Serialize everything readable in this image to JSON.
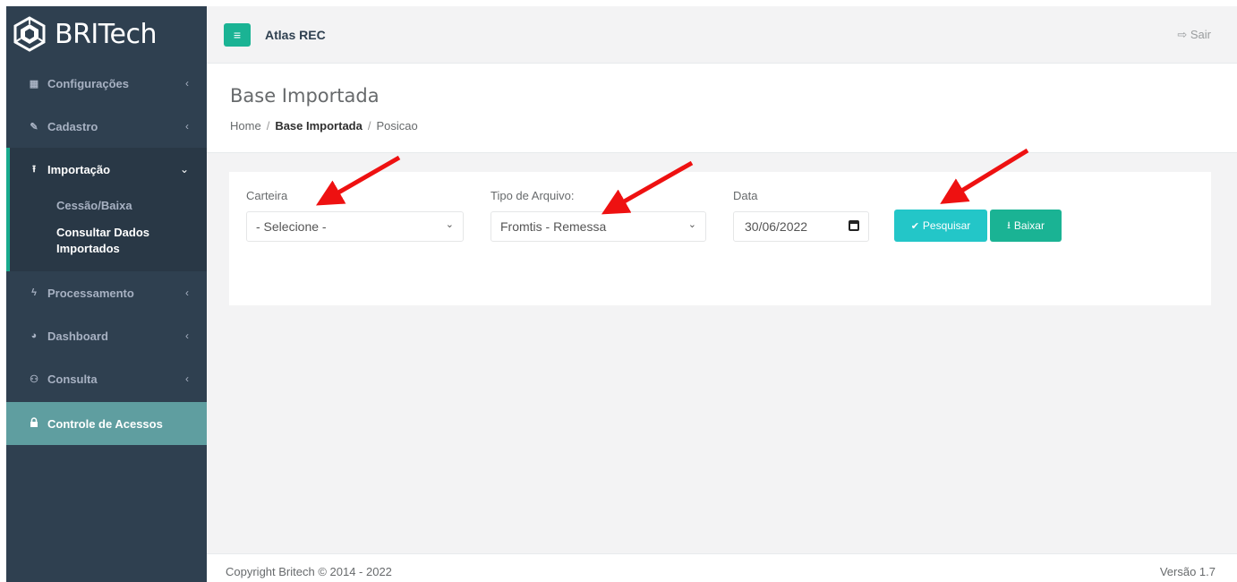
{
  "brand": {
    "name": "BRITech"
  },
  "sidebar": {
    "items": [
      {
        "label": "Configurações",
        "icon": "grid-icon"
      },
      {
        "label": "Cadastro",
        "icon": "edit-icon"
      },
      {
        "label": "Importação",
        "icon": "upload-icon"
      },
      {
        "label": "Processamento",
        "icon": "bolt-icon"
      },
      {
        "label": "Dashboard",
        "icon": "pie-chart-icon"
      },
      {
        "label": "Consulta",
        "icon": "binoculars-icon"
      },
      {
        "label": "Controle de Acessos",
        "icon": "lock-icon"
      }
    ],
    "submenu": [
      {
        "label": "Cessão/Baixa"
      },
      {
        "label": "Consultar Dados Importados"
      }
    ]
  },
  "topbar": {
    "app_title": "Atlas REC",
    "logout_label": "Sair"
  },
  "page": {
    "title": "Base Importada",
    "breadcrumb": [
      "Home",
      "Base Importada",
      "Posicao"
    ]
  },
  "form": {
    "carteira_label": "Carteira",
    "carteira_value": "- Selecione -",
    "tipo_label": "Tipo de Arquivo:",
    "tipo_value": "Fromtis - Remessa",
    "data_label": "Data",
    "data_value": "30/06/2022",
    "search_label": "Pesquisar",
    "download_label": "Baixar"
  },
  "footer": {
    "copyright": "Copyright Britech © 2014 - 2022",
    "version": "Versão 1.7"
  },
  "colors": {
    "sidebar": "#2f4050",
    "accent": "#1ab394",
    "info": "#23c6c8",
    "highlight": "#5f9ea0",
    "arrow": "#ee1111"
  }
}
